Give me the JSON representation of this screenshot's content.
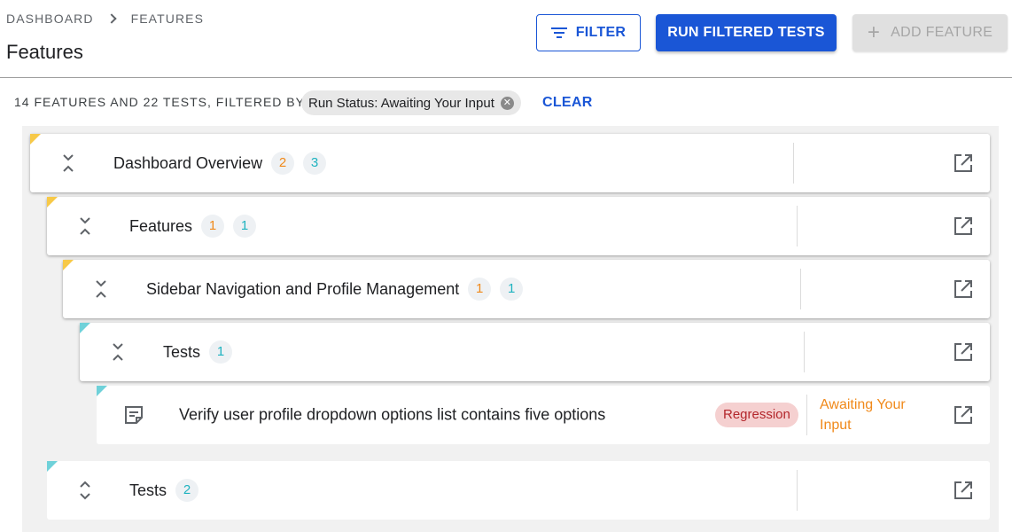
{
  "breadcrumb": {
    "root": "DASHBOARD",
    "current": "FEATURES"
  },
  "page_title": "Features",
  "toolbar": {
    "filter_label": "FILTER",
    "run_label": "RUN FILTERED TESTS",
    "add_label": "ADD FEATURE"
  },
  "filter_summary": {
    "text": "14 FEATURES AND 22 TESTS, FILTERED BY",
    "chip_label": "Run Status: Awaiting Your Input",
    "clear_label": "CLEAR"
  },
  "tree": [
    {
      "kind": "feature",
      "label": "Dashboard Overview",
      "features_count": "2",
      "tests_count": "3",
      "corner": "#f7c948",
      "toggle": "collapse"
    },
    {
      "kind": "feature",
      "label": "Features",
      "features_count": "1",
      "tests_count": "1",
      "corner": "#f7c948",
      "toggle": "collapse"
    },
    {
      "kind": "feature",
      "label": "Sidebar Navigation and Profile Management",
      "features_count": "1",
      "tests_count": "1",
      "corner": "#f7c948",
      "toggle": "collapse"
    },
    {
      "kind": "tests",
      "label": "Tests",
      "tests_count": "1",
      "corner": "#6fd1d9",
      "toggle": "collapse"
    },
    {
      "kind": "test",
      "label": "Verify user profile dropdown options list contains five options",
      "tag": "Regression",
      "status": "Awaiting Your Input",
      "corner": "#6fd1d9",
      "icon": "document-icon"
    },
    {
      "kind": "tests",
      "label": "Tests",
      "tests_count": "2",
      "corner": "#6fd1d9",
      "toggle": "expand"
    }
  ],
  "colors": {
    "primary": "#1a56d6",
    "feature_count": "#f0891a",
    "test_count": "#1fb3c0",
    "status_awaiting": "#f0891a",
    "regression_tag_bg": "#f5d0d0"
  }
}
